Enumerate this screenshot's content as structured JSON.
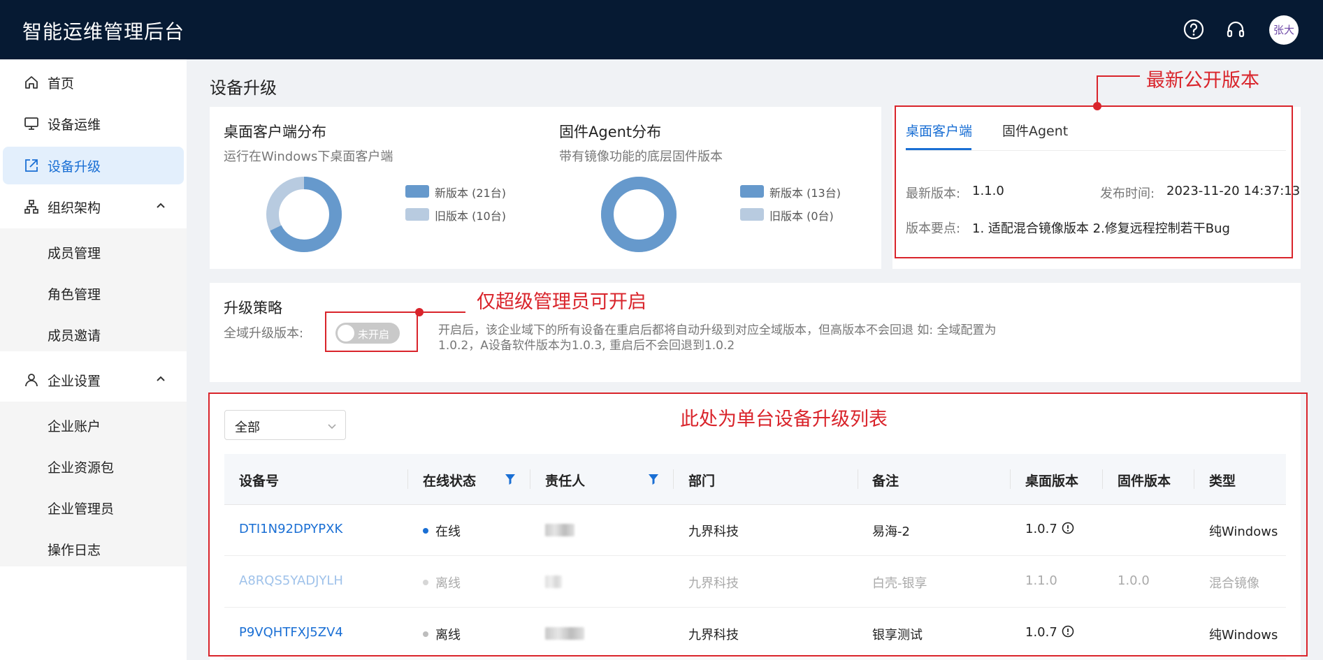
{
  "header": {
    "title": "智能运维管理后台",
    "help_icon": "help-circle-icon",
    "support_icon": "headset-icon",
    "avatar_text": "张大"
  },
  "sidebar": {
    "items": [
      {
        "label": "首页",
        "icon": "home-icon"
      },
      {
        "label": "设备运维",
        "icon": "monitor-icon"
      },
      {
        "label": "设备升级",
        "icon": "upgrade-icon",
        "active": true
      },
      {
        "label": "组织架构",
        "icon": "org-icon",
        "expanded": true
      },
      {
        "label": "企业设置",
        "icon": "user-icon",
        "expanded": true
      }
    ],
    "org_children": [
      "成员管理",
      "角色管理",
      "成员邀请"
    ],
    "enterprise_children": [
      "企业账户",
      "企业资源包",
      "企业管理员",
      "操作日志"
    ]
  },
  "page": {
    "title": "设备升级"
  },
  "distribution": {
    "desktop": {
      "title": "桌面客户端分布",
      "subtitle": "运行在Windows下桌面客户端",
      "new_label": "新版本 (21台)",
      "old_label": "旧版本 (10台)",
      "new_count": 21,
      "old_count": 10
    },
    "firmware": {
      "title": "固件Agent分布",
      "subtitle": "带有镜像功能的底层固件版本",
      "new_label": "新版本 (13台)",
      "old_label": "旧版本 (0台)",
      "new_count": 13,
      "old_count": 0
    },
    "colors": {
      "new": "#6699cc",
      "old": "#b8cbe0"
    }
  },
  "version_panel": {
    "tabs": [
      "桌面客户端",
      "固件Agent"
    ],
    "active_tab": 0,
    "latest_label": "最新版本:",
    "latest_value": "1.1.0",
    "release_label": "发布时间:",
    "release_value": "2023-11-20 14:37:13",
    "notes_label": "版本要点:",
    "notes_value": "1. 适配混合镜像版本 2.修复远程控制若干Bug"
  },
  "policy": {
    "title": "升级策略",
    "global_label": "全域升级版本:",
    "toggle_label": "未开启",
    "toggle_on": false,
    "description_line1": "开启后，该企业域下的所有设备在重启后都将自动升级到对应全域版本，但高版本不会回退 如: 全域配置为",
    "description_line2": "1.0.2，A设备软件版本为1.0.3, 重启后不会回退到1.0.2"
  },
  "annotations": {
    "latest_public": "最新公开版本",
    "super_admin_only": "仅超级管理员可开启",
    "single_device_list": "此处为单台设备升级列表",
    "color": "#d9242b"
  },
  "device_list": {
    "filter_value": "全部",
    "columns": [
      "设备号",
      "在线状态",
      "责任人",
      "部门",
      "备注",
      "桌面版本",
      "固件版本",
      "类型"
    ],
    "rows": [
      {
        "device_id": "DTI1N92DPYPXK",
        "status": "在线",
        "online": true,
        "department": "九界科技",
        "note": "易海-2",
        "desktop_version": "1.0.7",
        "desktop_outdated": true,
        "firmware_version": "",
        "type": "纯Windows",
        "dim": false
      },
      {
        "device_id": "A8RQS5YADJYLH",
        "status": "离线",
        "online": false,
        "department": "九界科技",
        "note": "白壳-银享",
        "desktop_version": "1.1.0",
        "desktop_outdated": false,
        "firmware_version": "1.0.0",
        "type": "混合镜像",
        "dim": true
      },
      {
        "device_id": "P9VQHTFXJ5ZV4",
        "status": "离线",
        "online": false,
        "department": "九界科技",
        "note": "银享测试",
        "desktop_version": "1.0.7",
        "desktop_outdated": true,
        "firmware_version": "",
        "type": "纯Windows",
        "dim": false
      }
    ]
  }
}
